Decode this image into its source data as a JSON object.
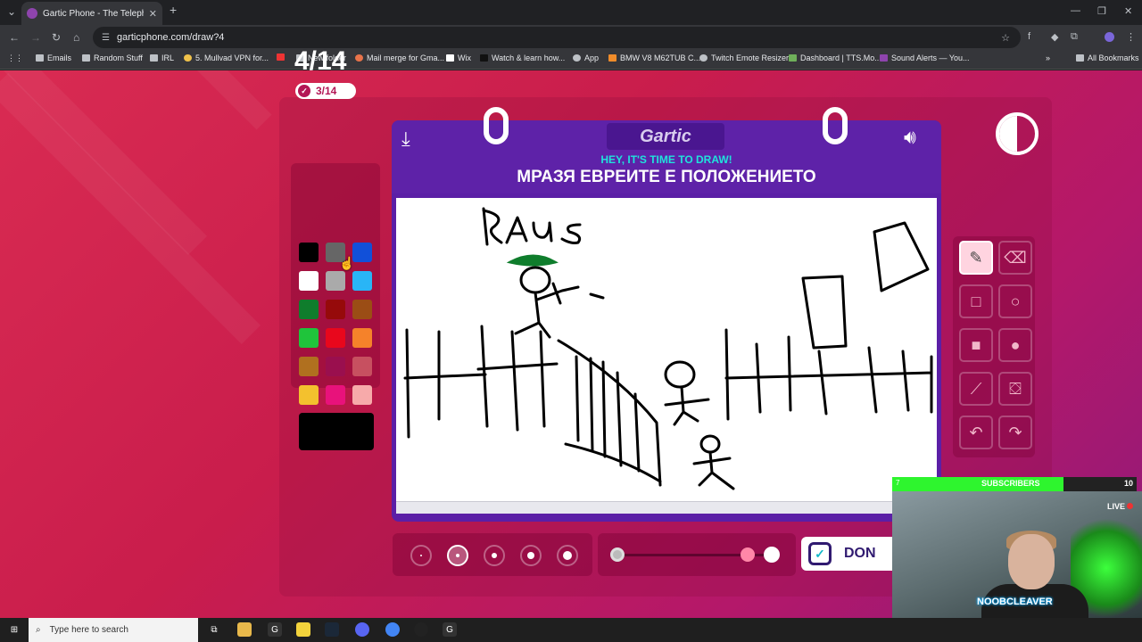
{
  "browser": {
    "tab_title": "Gartic Phone - The Telephone G",
    "url": "garticphone.com/draw?4",
    "bookmarks": [
      "Emails",
      "Random Stuff",
      "IRL",
      "5. Mullvad VPN for...",
      "",
      "New folder",
      "Mail merge for Gma...",
      "Wix",
      "Watch & learn how...",
      "App",
      "BMW V8 M62TUB C...",
      "Twitch Emote Resizer",
      "Dashboard | TTS.Mo...",
      "Sound Alerts — You..."
    ],
    "all_bookmarks": "All Bookmarks"
  },
  "game": {
    "round": "4/14",
    "done_count": "3/14",
    "logo": "Gartic",
    "subtitle": "HEY, IT'S TIME TO DRAW!",
    "prompt": "МРАЗЯ ЕВРЕИТЕ Е ПОЛОЖЕНИЕТО",
    "done_label": "DON",
    "canvas_text": "RAus",
    "colors": [
      "#000000",
      "#666666",
      "#1150d9",
      "#ffffff",
      "#aaaaaa",
      "#29b5f6",
      "#0f7d2c",
      "#960a0a",
      "#9b4d15",
      "#1fc43b",
      "#e8071c",
      "#f5822a",
      "#b0701f",
      "#9a0f4e",
      "#c75060",
      "#f3c12e",
      "#e8127b",
      "#f7aaaa"
    ],
    "current_color": "#000000",
    "pen_sizes": 5,
    "selected_size": 2,
    "opacity": 1.0,
    "tools": [
      "pen-icon",
      "eraser-icon",
      "square-outline-icon",
      "circle-outline-icon",
      "square-filled-icon",
      "circle-filled-icon",
      "line-icon",
      "bucket-icon",
      "undo-icon",
      "redo-icon"
    ]
  },
  "stream": {
    "subscribers_label": "SUBSCRIBERS",
    "subscribers_current": "7",
    "subscribers_goal": "10",
    "subscribers_progress": 0.7,
    "live": "LIVE",
    "streamer": "NOOBCLEAVER"
  },
  "taskbar": {
    "search_placeholder": "Type here to search"
  }
}
